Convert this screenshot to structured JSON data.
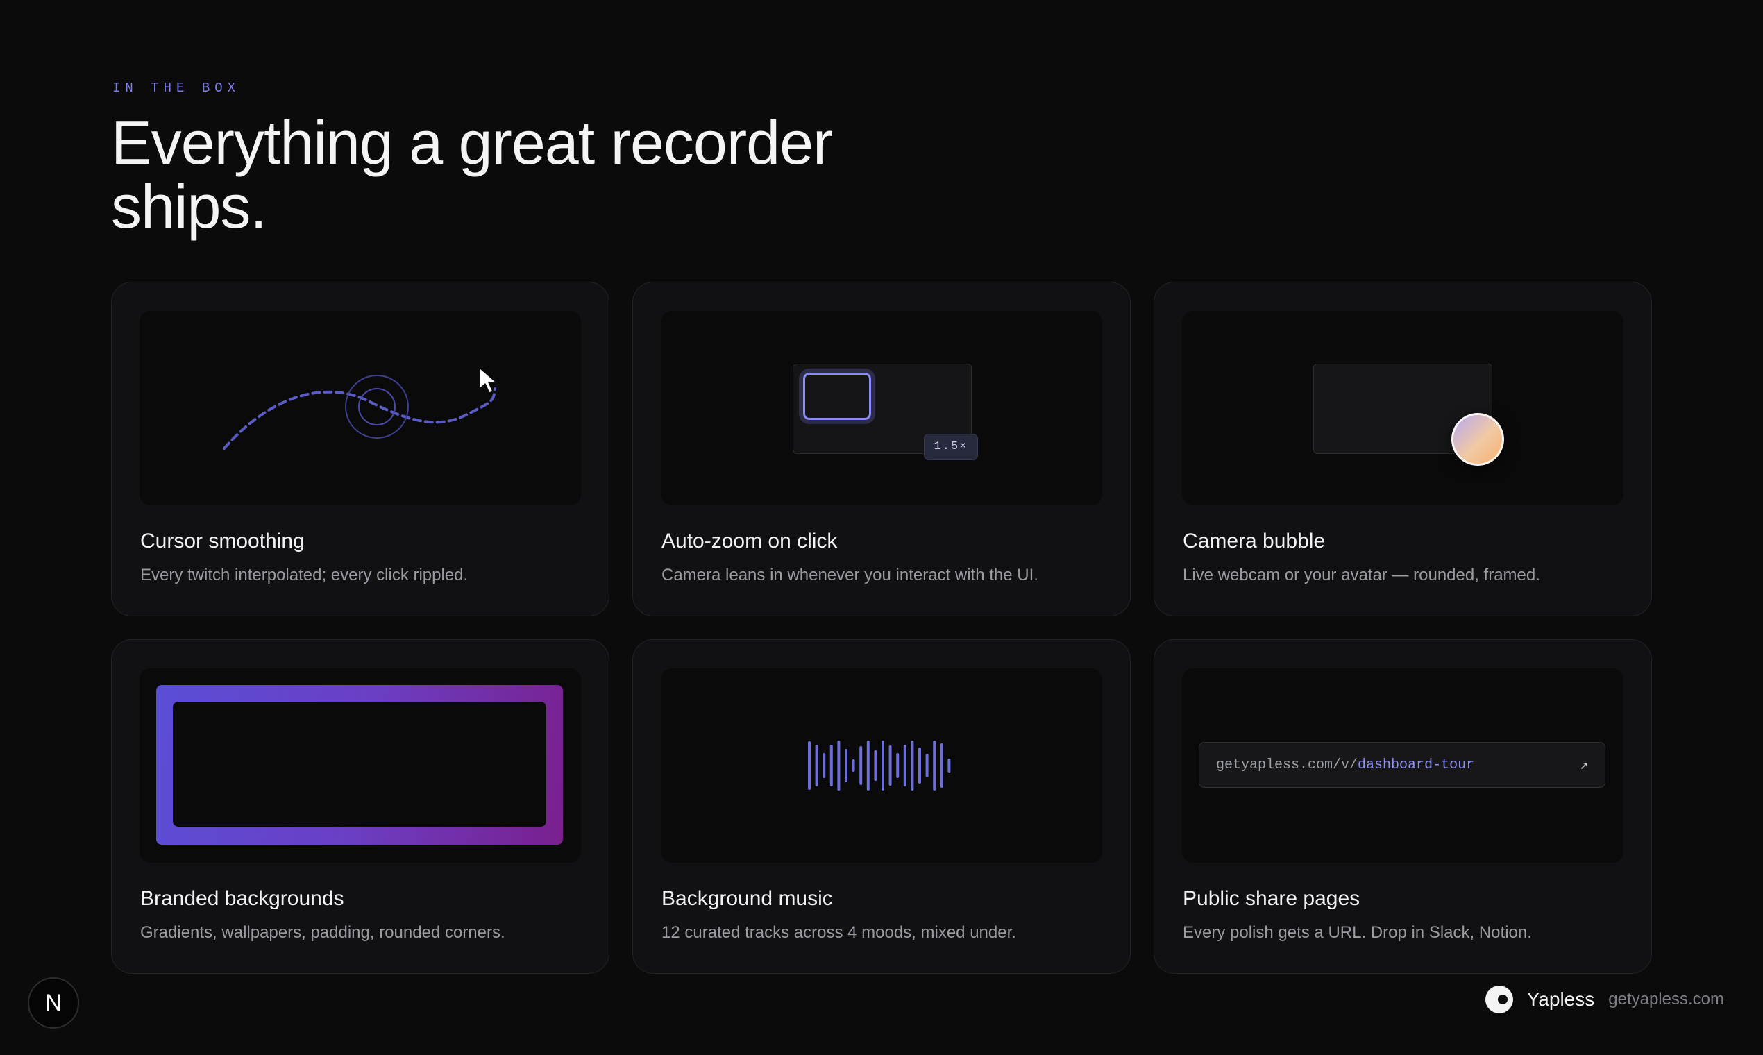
{
  "header": {
    "eyebrow": "IN THE BOX",
    "headline_line1": "Everything a great recorder",
    "headline_line2": "ships."
  },
  "features": [
    {
      "title": "Cursor smoothing",
      "desc": "Every twitch interpolated; every click rippled."
    },
    {
      "title": "Auto-zoom on click",
      "desc": "Camera leans in whenever you interact with the UI.",
      "zoom_label": "1.5×"
    },
    {
      "title": "Camera bubble",
      "desc": "Live webcam or your avatar — rounded, framed."
    },
    {
      "title": "Branded backgrounds",
      "desc": "Gradients, wallpapers, padding, rounded corners."
    },
    {
      "title": "Background music",
      "desc": "12 curated tracks across 4 moods, mixed under."
    },
    {
      "title": "Public share pages",
      "desc": "Every polish gets a URL. Drop in Slack, Notion.",
      "url_prefix": "getyapless.com/v/",
      "url_slug": "dashboard-tour"
    }
  ],
  "footer": {
    "badge": "N",
    "brand_name": "Yapless",
    "brand_url": "getyapless.com"
  },
  "colors": {
    "accent": "#7d7de8",
    "background": "#0b0b0c",
    "card": "#111113"
  },
  "icons": {
    "cursor": "cursor-arrow-icon",
    "share_arrow": "external-link-icon"
  }
}
